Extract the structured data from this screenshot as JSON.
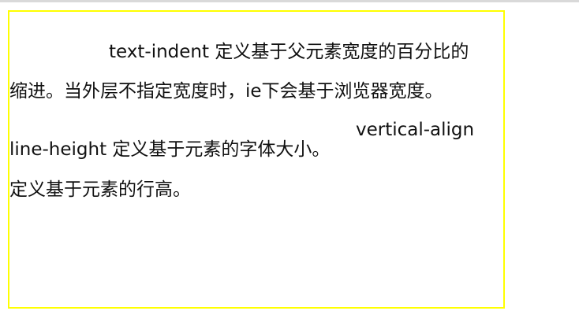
{
  "demo": {
    "text_indent_line": "text-indent 定义基于父元素宽度的百分比的",
    "text_indent_cont": "缩进。当外层不指定宽度时，ie下会基于浏览器宽度。",
    "line_height_line": "line-height 定义基于元素的字体大小。",
    "vertical_align_word": "vertical-align",
    "vertical_align_cont": "定义基于元素的行高。"
  },
  "colors": {
    "box_border": "#ffff00",
    "text": "#111111",
    "top_rule": "#d9d9d9"
  }
}
